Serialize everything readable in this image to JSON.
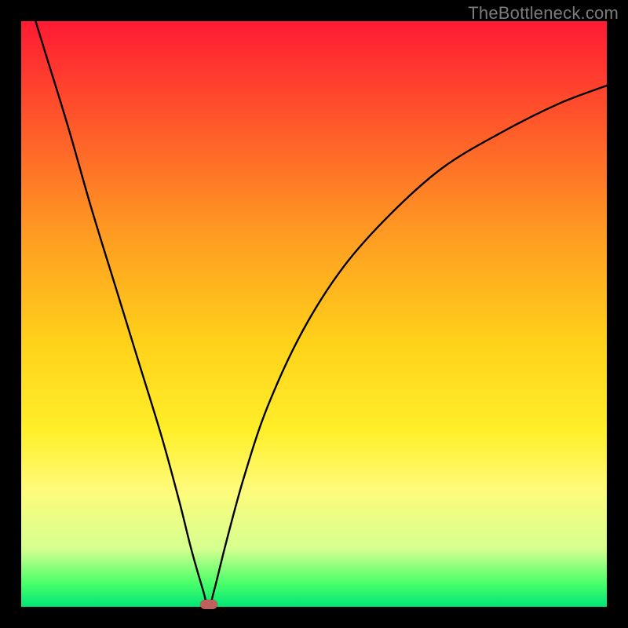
{
  "watermark": "TheBottleneck.com",
  "colors": {
    "frame": "#000000",
    "curve": "#000000",
    "marker": "#c0605c",
    "gradient_top": "#ff1a33",
    "gradient_bottom": "#00e676"
  },
  "chart_data": {
    "type": "line",
    "title": "",
    "xlabel": "",
    "ylabel": "",
    "xlim": [
      0,
      100
    ],
    "ylim": [
      0,
      100
    ],
    "minimum_x": 32,
    "minimum_y": 0,
    "series": [
      {
        "name": "bottleneck-curve",
        "x": [
          0,
          4,
          8,
          12,
          16,
          20,
          24,
          27,
          29,
          31,
          32,
          33,
          35,
          38,
          42,
          48,
          55,
          63,
          72,
          82,
          92,
          100
        ],
        "values": [
          108,
          95,
          82,
          68,
          55,
          42,
          29,
          18,
          10,
          3,
          0,
          3,
          11,
          22,
          34,
          47,
          58,
          67,
          75,
          81,
          86,
          89
        ]
      }
    ],
    "annotations": [
      {
        "name": "minimum-marker",
        "x": 32,
        "y": 0
      }
    ]
  }
}
